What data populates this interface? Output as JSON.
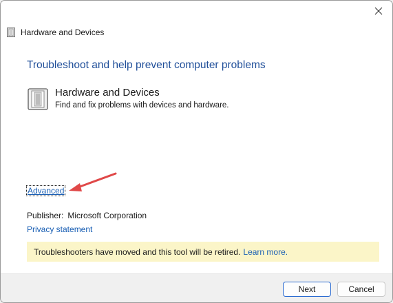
{
  "window": {
    "title": "Hardware and Devices",
    "close_symbol": "✕"
  },
  "main": {
    "heading": "Troubleshoot and help prevent computer problems",
    "item": {
      "title": "Hardware and Devices",
      "description": "Find and fix problems with devices and hardware.",
      "icon": "troubleshooter-icon"
    },
    "advanced_label": "Advanced",
    "publisher_label": "Publisher:",
    "publisher_value": "Microsoft Corporation",
    "privacy_label": "Privacy statement",
    "notice_text": "Troubleshooters have moved and this tool will be retired.",
    "notice_link": "Learn more."
  },
  "footer": {
    "next_label": "Next",
    "cancel_label": "Cancel"
  },
  "colors": {
    "heading": "#1f4e99",
    "link": "#1a5fb4",
    "notice_bg": "#fbf5c8",
    "arrow": "#e04848"
  }
}
